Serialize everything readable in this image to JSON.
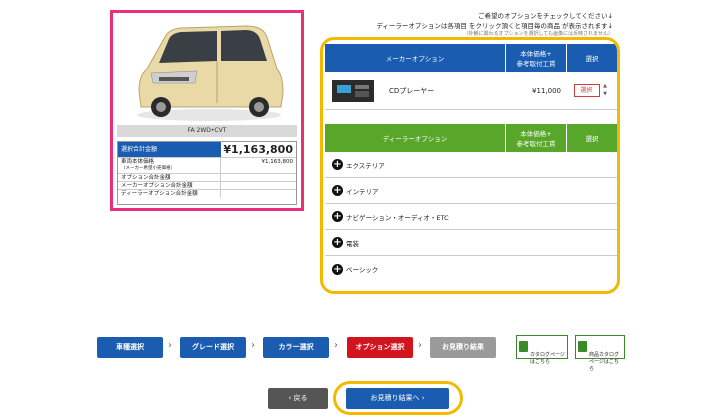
{
  "instructions": {
    "line1": "ご希望のオプションをチェックしてください↓",
    "line2": "ディーラーオプションは各項目 をクリック頂くと項目毎の商品 が表示されます↓",
    "line3": "（外観に関わるオプションを選択しても画像には反映されません）"
  },
  "car": {
    "grade": "FA 2WD•CVT",
    "total_label": "選択合計金額",
    "total_value": "¥1,163,800",
    "rows": [
      {
        "label": "車両本体価格",
        "sub": "（メーカー希望小売価格）",
        "value": "¥1,163,800"
      },
      {
        "label": "オプション合計金額",
        "sub": "",
        "value": ""
      },
      {
        "label": "メーカーオプション合計金額",
        "sub": "",
        "value": ""
      },
      {
        "label": "ディーラーオプション合計金額",
        "sub": "",
        "value": ""
      }
    ]
  },
  "maker": {
    "head_label": "メーカーオプション",
    "price_label": "本体価格+\n参考取付工賃",
    "select_label": "選択",
    "item_name": "CDプレーヤー",
    "item_price": "¥11,000",
    "item_select": "選択"
  },
  "dealer": {
    "head_label": "ディーラーオプション",
    "price_label": "本体価格+\n参考取付工賃",
    "select_label": "選択",
    "items": [
      "エクステリア",
      "インテリア",
      "ナビゲーション・オーディオ・ETC",
      "電装",
      "ベーシック"
    ]
  },
  "steps": [
    "車種選択",
    "グレード選択",
    "カラー選択",
    "オプション選択",
    "お見積り結果"
  ],
  "catalog_digital": "カタログページ\nはこちら",
  "catalog_product": "商品カタログ\nページはこちら",
  "back_label": "戻る",
  "result_label": "お見積り結果へ"
}
